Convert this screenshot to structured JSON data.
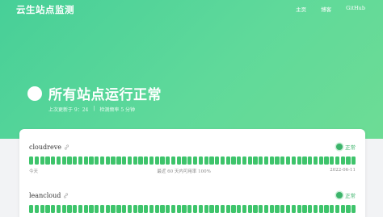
{
  "header": {
    "site_title": "云生站点监测",
    "nav": [
      {
        "label": "主页"
      },
      {
        "label": "博客"
      },
      {
        "label": "GitHub"
      }
    ]
  },
  "status": {
    "title": "所有站点运行正常",
    "last_update": "上次更新于 9：24",
    "separator": "|",
    "interval": "检测频率 5 分钟"
  },
  "colors": {
    "hero_start": "#47cf98",
    "hero_end": "#6ddc95",
    "ok_green": "#3ec46b"
  },
  "monitors": [
    {
      "name": "cloudreve",
      "status": "正常",
      "bar_count": 60,
      "left_label": "今天",
      "center_label": "最近 60 天内可用率 100%",
      "right_label": "2022-06-11"
    },
    {
      "name": "leancloud",
      "status": "正常",
      "bar_count": 60
    }
  ]
}
